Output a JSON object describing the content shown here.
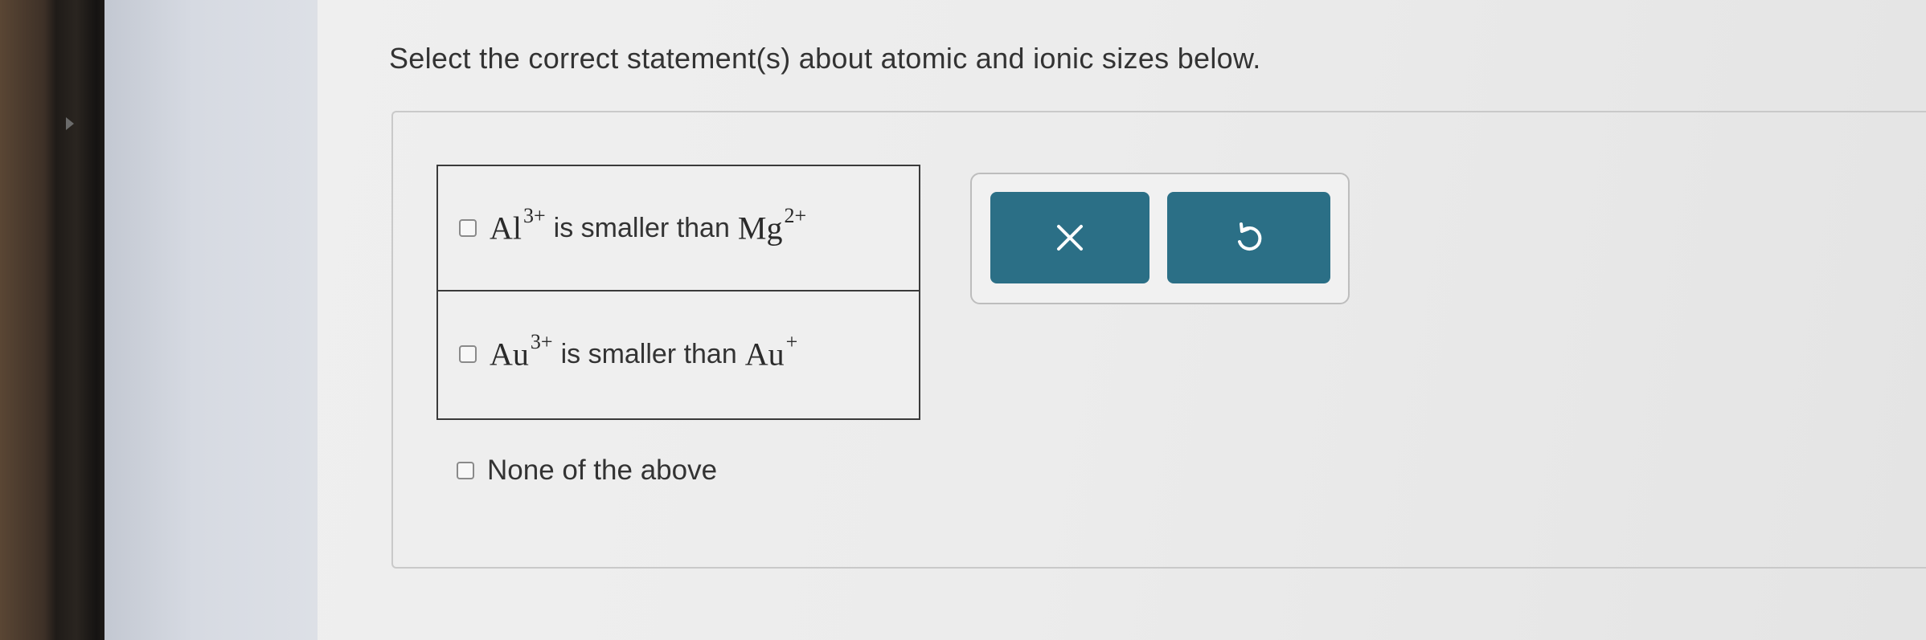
{
  "question": {
    "prompt": "Select the correct statement(s) about atomic and ionic sizes below."
  },
  "options": [
    {
      "ion_a": "Al",
      "charge_a": "3+",
      "relation": "is smaller than",
      "ion_b": "Mg",
      "charge_b": "2+",
      "checked": false
    },
    {
      "ion_a": "Au",
      "charge_a": "3+",
      "relation": "is smaller than",
      "ion_b": "Au",
      "charge_b": "+",
      "checked": false
    }
  ],
  "none_option": {
    "label": "None of the above",
    "checked": false
  },
  "buttons": {
    "clear_icon": "x-icon",
    "undo_icon": "undo-icon",
    "color": "#2b6f86"
  }
}
